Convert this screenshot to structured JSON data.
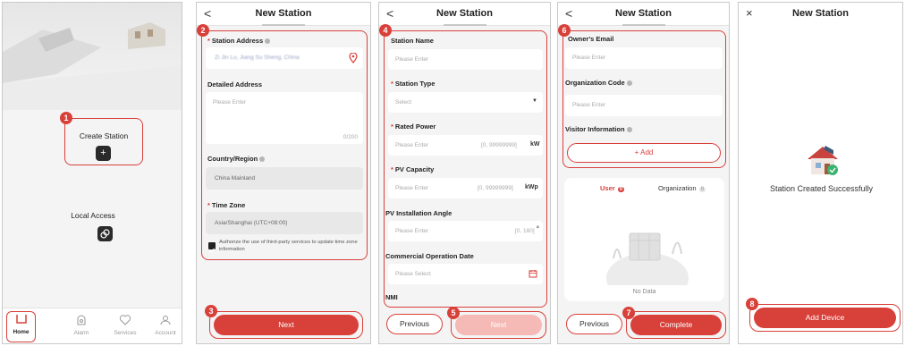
{
  "steps": [
    "1",
    "2",
    "3",
    "4",
    "5",
    "6",
    "7",
    "8"
  ],
  "home": {
    "create_station": "Create Station",
    "local_access": "Local Access",
    "tabs": [
      {
        "label": "Home",
        "icon": "home-icon"
      },
      {
        "label": "Alarm",
        "icon": "alarm-icon"
      },
      {
        "label": "Services",
        "icon": "services-icon"
      },
      {
        "label": "Account",
        "icon": "account-icon"
      }
    ]
  },
  "header": {
    "title": "New Station",
    "back": "<",
    "close": "×"
  },
  "address_step": {
    "station_address": "Station Address",
    "address_value": "Zi Jin Lu, Jiang Su Sheng, China",
    "detailed_address": "Detailed Address",
    "detailed_placeholder": "Please Enter",
    "char_count": "0/200",
    "country_region": "Country/Region",
    "country_value": "China Mainland",
    "time_zone": "Time Zone",
    "time_zone_value": "Asia/Shanghai  (UTC+08:00)",
    "authorize_text": "Authorize the use of third-party services to update time zone information",
    "next": "Next"
  },
  "info_step": {
    "station_name": "Station Name",
    "please_enter": "Please Enter",
    "station_type": "Station Type",
    "select": "Select",
    "rated_power": "Rated Power",
    "rated_range": "[0, 99999999]",
    "rated_unit": "kW",
    "pv_capacity": "PV Capacity",
    "pv_range": "[0, 99999999]",
    "pv_unit": "kWp",
    "pv_angle": "PV Installation Angle",
    "angle_range": "[0, 180]",
    "angle_unit": "°",
    "commercial_date": "Commercial Operation Date",
    "please_select": "Please Select",
    "nmi": "NMI",
    "previous": "Previous",
    "next": "Next"
  },
  "owner_step": {
    "owner_email": "Owner's Email",
    "please_enter": "Please Enter",
    "org_code": "Organization Code",
    "visitor_info": "Visitor Information",
    "add": "+ Add",
    "tab_user": "User",
    "tab_user_count": "0",
    "tab_org": "Organization",
    "tab_org_count": "0",
    "no_data": "No Data",
    "previous": "Previous",
    "complete": "Complete"
  },
  "success_step": {
    "message": "Station Created Successfully",
    "add_device": "Add Device"
  },
  "colors": {
    "accent": "#d8403a",
    "accent_light": "#f5b9b6",
    "panel_bg": "#f4f4f4"
  }
}
